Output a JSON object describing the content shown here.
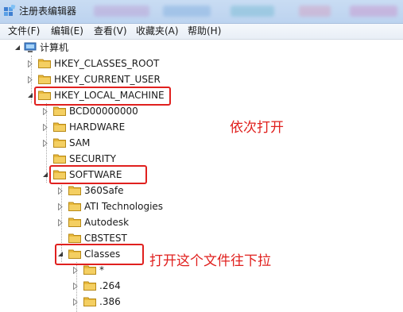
{
  "window": {
    "title": "注册表编辑器"
  },
  "menu": [
    {
      "label": "文件(F)"
    },
    {
      "label": "编辑(E)"
    },
    {
      "label": "查看(V)"
    },
    {
      "label": "收藏夹(A)"
    },
    {
      "label": "帮助(H)"
    }
  ],
  "tree": {
    "root": "计算机",
    "hives": [
      {
        "label": "HKEY_CLASSES_ROOT",
        "state": "collapsed"
      },
      {
        "label": "HKEY_CURRENT_USER",
        "state": "collapsed"
      },
      {
        "label": "HKEY_LOCAL_MACHINE",
        "state": "expanded"
      }
    ],
    "hklm_children": [
      {
        "label": "BCD00000000",
        "state": "collapsed"
      },
      {
        "label": "HARDWARE",
        "state": "collapsed"
      },
      {
        "label": "SAM",
        "state": "collapsed"
      },
      {
        "label": "SECURITY",
        "state": "leaf"
      },
      {
        "label": "SOFTWARE",
        "state": "expanded"
      }
    ],
    "software_children": [
      {
        "label": "360Safe",
        "state": "collapsed"
      },
      {
        "label": "ATI Technologies",
        "state": "collapsed"
      },
      {
        "label": "Autodesk",
        "state": "collapsed"
      },
      {
        "label": "CBSTEST",
        "state": "leaf"
      },
      {
        "label": "Classes",
        "state": "expanded"
      }
    ],
    "classes_children": [
      {
        "label": "*",
        "state": "collapsed"
      },
      {
        "label": ".264",
        "state": "collapsed"
      },
      {
        "label": ".386",
        "state": "collapsed"
      }
    ]
  },
  "annotations": {
    "open_in_order": "依次打开",
    "open_and_scroll": "打开这个文件往下拉"
  },
  "colors": {
    "callout": "#e0201e",
    "folder": "#e8b83a"
  }
}
